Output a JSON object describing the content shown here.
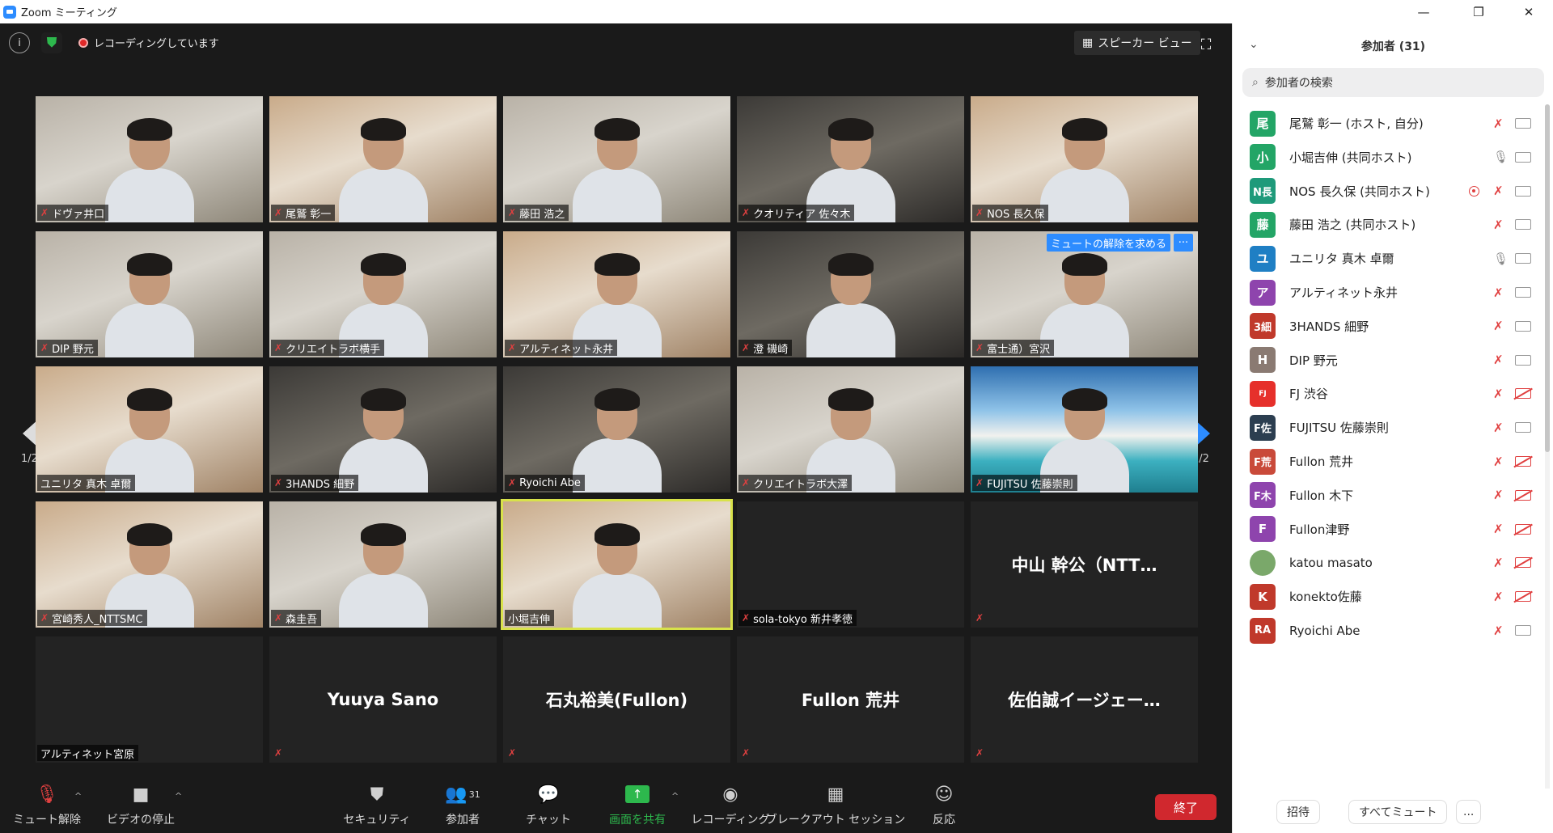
{
  "window": {
    "title": "Zoom ミーティング"
  },
  "topbar": {
    "recording_status": "レコーディングしています",
    "view_label": "スピーカー ビュー"
  },
  "grid": {
    "page_indicator_left": "1/2",
    "page_indicator_right": "1/2",
    "unmute_request_label": "ミュートの解除を求める",
    "tiles": [
      {
        "name": "ドヴァ井口",
        "kind": "office"
      },
      {
        "name": "尾鷲 彰一",
        "kind": "warm"
      },
      {
        "name": "藤田 浩之",
        "kind": "office"
      },
      {
        "name": "クオリティア 佐々木",
        "kind": "dark"
      },
      {
        "name": "NOS 長久保",
        "kind": "warm"
      },
      {
        "name": "DIP 野元",
        "kind": "office"
      },
      {
        "name": "クリエイトラボ横手",
        "kind": "office"
      },
      {
        "name": "アルティネット永井",
        "kind": "warm"
      },
      {
        "name": "澄 磯崎",
        "kind": "dark"
      },
      {
        "name": "富士通）宮沢",
        "kind": "office"
      },
      {
        "name": "ユニリタ 真木 卓爾",
        "kind": "warm"
      },
      {
        "name": "3HANDS 細野",
        "kind": "dark"
      },
      {
        "name": "Ryoichi Abe",
        "kind": "dark"
      },
      {
        "name": "クリエイトラボ大澤",
        "kind": "office"
      },
      {
        "name": "FUJITSU 佐藤崇則",
        "kind": "beach"
      },
      {
        "name": "宮崎秀人_NTTSMC",
        "kind": "warm"
      },
      {
        "name": "森圭吾",
        "kind": "office"
      },
      {
        "name": "小堀吉伸",
        "kind": "warm"
      },
      {
        "name": "sola-tokyo 新井孝徳",
        "kind": "black"
      },
      {
        "name": "中山 幹公（NTT…",
        "kind": "text"
      },
      {
        "name": "アルティネット宮原",
        "kind": "text"
      },
      {
        "name": "Yuuya Sano",
        "kind": "text"
      },
      {
        "name": "石丸裕美(Fullon)",
        "kind": "text"
      },
      {
        "name": "Fullon 荒井",
        "kind": "text"
      },
      {
        "name": "佐伯誠イージェー…",
        "kind": "text"
      }
    ]
  },
  "toolbar": {
    "unmute": "ミュート解除",
    "stop_video": "ビデオの停止",
    "security": "セキュリティ",
    "participants": "参加者",
    "participants_count": "31",
    "chat": "チャット",
    "share": "画面を共有",
    "record": "レコーディング",
    "breakout": "ブレークアウト セッション",
    "reactions": "反応",
    "end": "終了"
  },
  "panel": {
    "title": "参加者 (31)",
    "search_placeholder": "参加者の検索",
    "participants": [
      {
        "avatar": "尾",
        "color": "#23a566",
        "name": "尾鷲 彰一 (ホスト, 自分)",
        "mic": "off",
        "cam": "on",
        "rec": false
      },
      {
        "avatar": "小",
        "color": "#23a566",
        "name": "小堀吉伸 (共同ホスト)",
        "mic": "on",
        "cam": "on",
        "rec": false
      },
      {
        "avatar": "N長",
        "color": "#1e9a7a",
        "name": "NOS 長久保 (共同ホスト)",
        "mic": "off",
        "cam": "on",
        "rec": true
      },
      {
        "avatar": "藤",
        "color": "#23a566",
        "name": "藤田 浩之 (共同ホスト)",
        "mic": "off",
        "cam": "on",
        "rec": false
      },
      {
        "avatar": "ユ",
        "color": "#1f7fc4",
        "name": "ユニリタ 真木 卓爾",
        "mic": "on",
        "cam": "on",
        "rec": false
      },
      {
        "avatar": "ア",
        "color": "#8e44ad",
        "name": "アルティネット永井",
        "mic": "off",
        "cam": "on",
        "rec": false
      },
      {
        "avatar": "3細",
        "color": "#c0392b",
        "name": "3HANDS 細野",
        "mic": "off",
        "cam": "on",
        "rec": false
      },
      {
        "avatar": "H",
        "color": "#8a7a72",
        "name": "DIP 野元",
        "mic": "off",
        "cam": "on",
        "rec": false
      },
      {
        "avatar": "FJ",
        "color": "#e6302b",
        "name": "FJ 渋谷",
        "mic": "off",
        "cam": "off",
        "rec": false
      },
      {
        "avatar": "F佐",
        "color": "#2c3e50",
        "name": "FUJITSU 佐藤崇則",
        "mic": "off",
        "cam": "on",
        "rec": false
      },
      {
        "avatar": "F荒",
        "color": "#c94a3a",
        "name": "Fullon 荒井",
        "mic": "off",
        "cam": "off",
        "rec": false
      },
      {
        "avatar": "F木",
        "color": "#8e44ad",
        "name": "Fullon 木下",
        "mic": "off",
        "cam": "off",
        "rec": false
      },
      {
        "avatar": "F",
        "color": "#8e44ad",
        "name": "Fullon津野",
        "mic": "off",
        "cam": "off",
        "rec": false
      },
      {
        "avatar": "",
        "color": "#7aa86a",
        "name": "katou masato",
        "mic": "off",
        "cam": "off",
        "rec": false
      },
      {
        "avatar": "K",
        "color": "#c0392b",
        "name": "konekto佐藤",
        "mic": "off",
        "cam": "off",
        "rec": false
      },
      {
        "avatar": "RA",
        "color": "#c0392b",
        "name": "Ryoichi Abe",
        "mic": "off",
        "cam": "on",
        "rec": false
      }
    ],
    "footer": {
      "invite": "招待",
      "mute_all": "すべてミュート",
      "more": "..."
    }
  }
}
